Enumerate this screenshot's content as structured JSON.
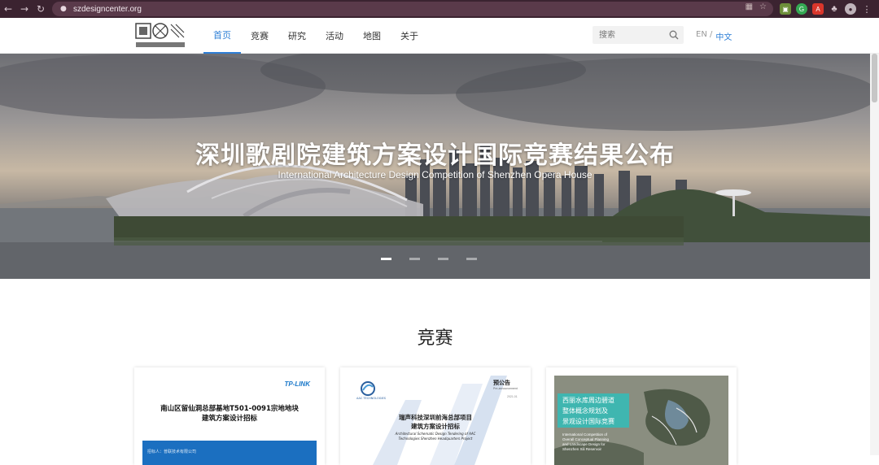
{
  "browser": {
    "url": "szdesigncenter.org"
  },
  "header": {
    "nav": [
      {
        "label": "首页"
      },
      {
        "label": "竞赛"
      },
      {
        "label": "研究"
      },
      {
        "label": "活动"
      },
      {
        "label": "地图"
      },
      {
        "label": "关于"
      }
    ],
    "search_placeholder": "搜索",
    "lang_en": "EN /",
    "lang_cn": "中文"
  },
  "hero": {
    "title": "深圳歌剧院建筑方案设计国际竞赛结果公布",
    "subtitle": "International Architecture Design Competition of Shenzhen Opera House",
    "slide_count": 4,
    "active_slide": 1
  },
  "section": {
    "title": "竞赛"
  },
  "cards": {
    "card1": {
      "brand": "TP-LINK",
      "line1": "南山区留仙洞总部基地T501-0091宗地地块",
      "line2": "建筑方案设计招标",
      "footer": "招标人：普联技术有限公司"
    },
    "card2": {
      "notice": "预公告",
      "notice_en": "Pre-announcement",
      "date": "2021.01",
      "company": "AAC TECHNOLOGIES",
      "line1": "瑞声科技深圳前海总部项目",
      "line2": "建筑方案设计招标",
      "line3": "Architectural Schematic Design Tendering of AAC",
      "line4": "Technologies Shenzhen Headquarters Project"
    },
    "card3": {
      "cn1": "西丽水库周边碧道",
      "cn2": "整体概念规划及",
      "cn3": "景观设计国际竞赛",
      "en1": "International Competition of",
      "en2": "Overall Conceptual Planning",
      "en3": "and Landscape Design for",
      "en4": "Shenzhen Xili Reservoir"
    }
  }
}
